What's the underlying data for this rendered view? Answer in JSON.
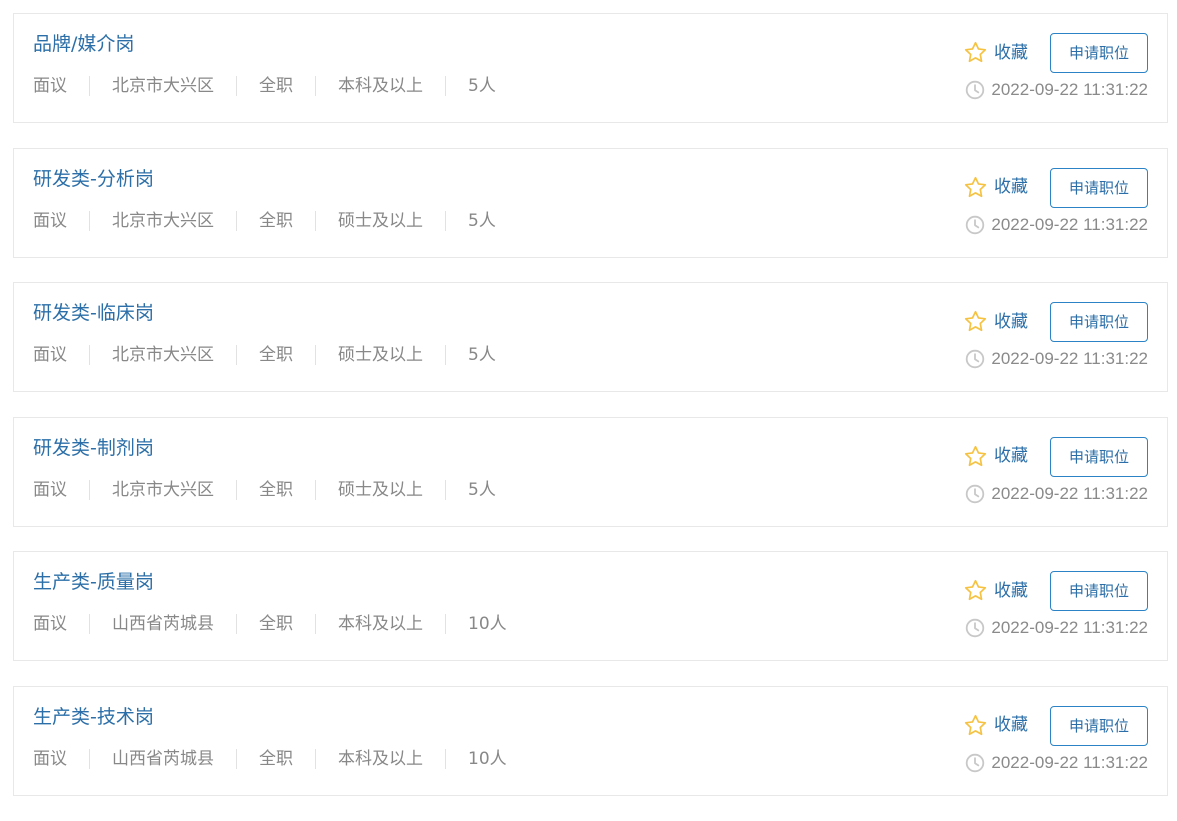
{
  "colors": {
    "title": "#2c6fa8",
    "meta_text": "#888888",
    "separator": "#e2e2e2",
    "star": "#f5c242",
    "button_border": "#2c84c6",
    "clock": "#c8c8c8",
    "card_border": "#e8e8e8"
  },
  "icons": {
    "favorite": "star-outline-icon",
    "time": "clock-icon"
  },
  "jobs": [
    {
      "title": "品牌/媒介岗",
      "salary": "面议",
      "location": "北京市大兴区",
      "type": "全职",
      "education": "本科及以上",
      "headcount": "5人",
      "favorite_label": "收藏",
      "apply_label": "申请职位",
      "time": "2022-09-22 11:31:22"
    },
    {
      "title": "研发类-分析岗",
      "salary": "面议",
      "location": "北京市大兴区",
      "type": "全职",
      "education": "硕士及以上",
      "headcount": "5人",
      "favorite_label": "收藏",
      "apply_label": "申请职位",
      "time": "2022-09-22 11:31:22"
    },
    {
      "title": "研发类-临床岗",
      "salary": "面议",
      "location": "北京市大兴区",
      "type": "全职",
      "education": "硕士及以上",
      "headcount": "5人",
      "favorite_label": "收藏",
      "apply_label": "申请职位",
      "time": "2022-09-22 11:31:22"
    },
    {
      "title": "研发类-制剂岗",
      "salary": "面议",
      "location": "北京市大兴区",
      "type": "全职",
      "education": "硕士及以上",
      "headcount": "5人",
      "favorite_label": "收藏",
      "apply_label": "申请职位",
      "time": "2022-09-22 11:31:22"
    },
    {
      "title": "生产类-质量岗",
      "salary": "面议",
      "location": "山西省芮城县",
      "type": "全职",
      "education": "本科及以上",
      "headcount": "10人",
      "favorite_label": "收藏",
      "apply_label": "申请职位",
      "time": "2022-09-22 11:31:22"
    },
    {
      "title": "生产类-技术岗",
      "salary": "面议",
      "location": "山西省芮城县",
      "type": "全职",
      "education": "本科及以上",
      "headcount": "10人",
      "favorite_label": "收藏",
      "apply_label": "申请职位",
      "time": "2022-09-22 11:31:22"
    }
  ]
}
